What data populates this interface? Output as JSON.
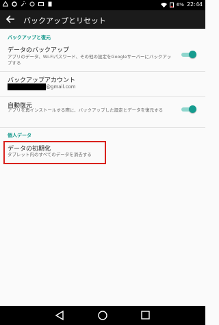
{
  "statusbar": {
    "battery_percent": "6%",
    "time": "22:44"
  },
  "appbar": {
    "title": "バックアップとリセット"
  },
  "sections": {
    "backup_header": "バックアップと復元",
    "personal_header": "個人データ"
  },
  "items": {
    "data_backup": {
      "title": "データのバックアップ",
      "summary": "アプリのデータ、Wi-Fiパスワード、その他の設定をGoogleサーバーにバックアップする",
      "enabled": true
    },
    "backup_account": {
      "title": "バックアップアカウント",
      "email_suffix": "@gmail.com"
    },
    "auto_restore": {
      "title": "自動復元",
      "summary": "アプリを再インストールする際に、バックアップした設定とデータを復元する",
      "enabled": true
    },
    "factory_reset": {
      "title": "データの初期化",
      "summary": "タブレット内のすべてのデータを消去する"
    }
  },
  "colors": {
    "accent": "#14998c",
    "highlight": "#d9211c"
  }
}
